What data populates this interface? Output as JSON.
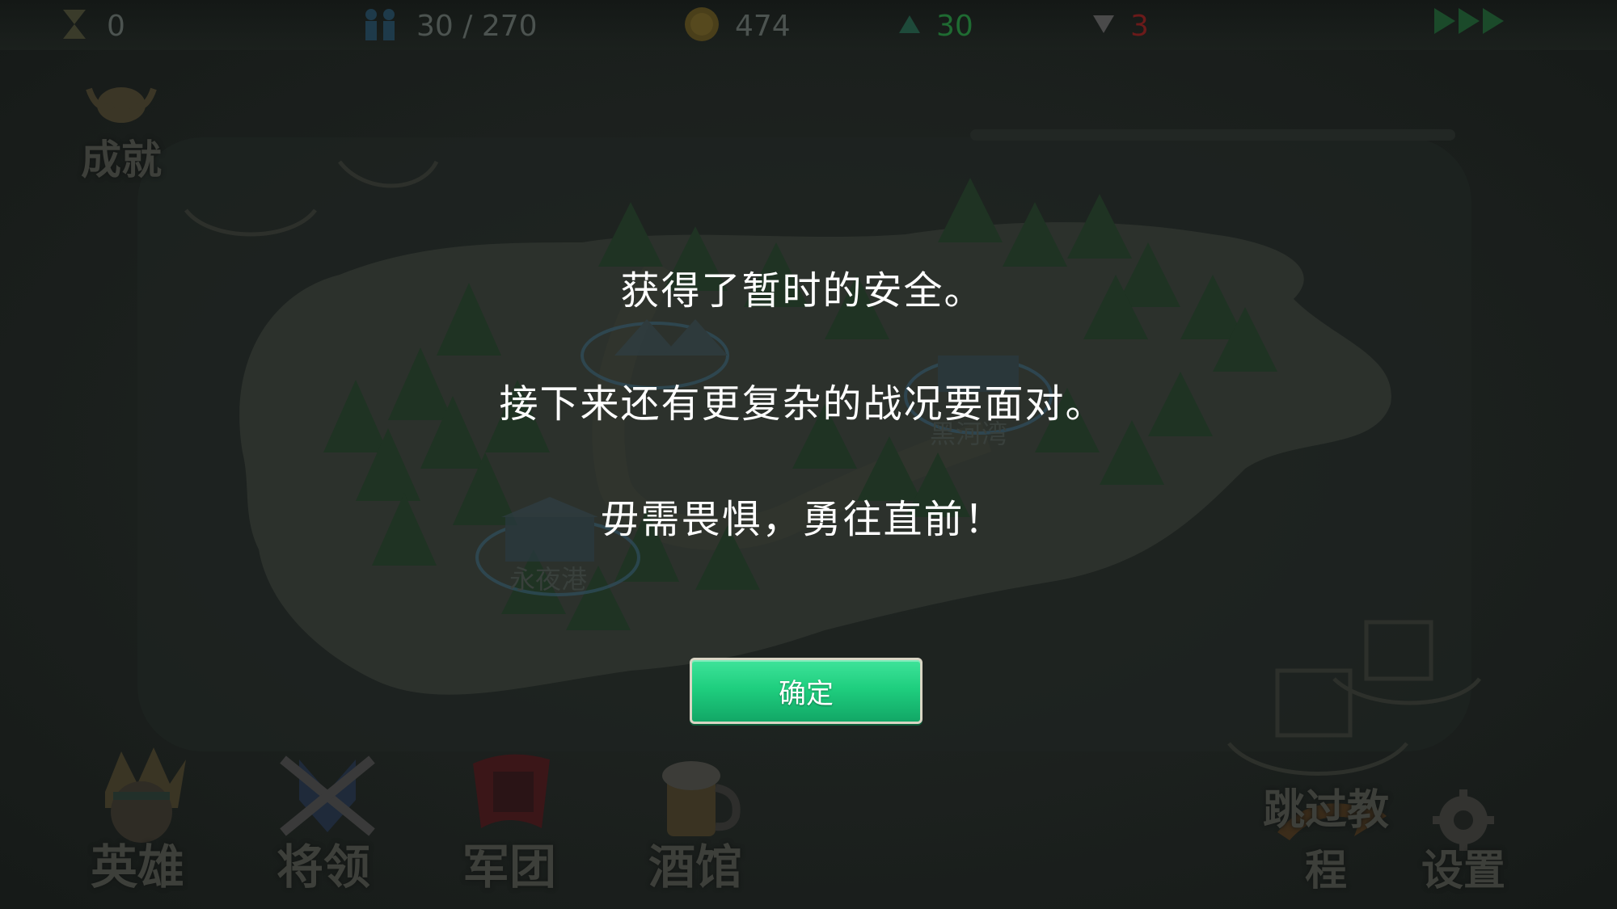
{
  "hud": {
    "score": "0",
    "population": "30 / 270",
    "gold": "474",
    "up_count": "30",
    "down_count": "3"
  },
  "side_menu": {
    "achievements_label": "成就"
  },
  "map_labels": {
    "port": "永夜港",
    "bay": "黑河湾"
  },
  "dialog": {
    "line1": "获得了暂时的安全。",
    "line2": "接下来还有更复杂的战况要面对。",
    "line3": "毋需畏惧，勇往直前！",
    "confirm_label": "确定"
  },
  "bottom_menu": {
    "hero_label": "英雄",
    "general_label": "将领",
    "legion_label": "军团",
    "tavern_label": "酒馆",
    "skip_label": "跳过教程",
    "settings_label": "设置"
  },
  "colors": {
    "background": "#1c211f",
    "island": "#2a2e2a",
    "trees": "#1e3322",
    "confirm_button": "#1fcf7f",
    "up_green": "#1f6b32",
    "down_red": "#6b1a1a"
  }
}
